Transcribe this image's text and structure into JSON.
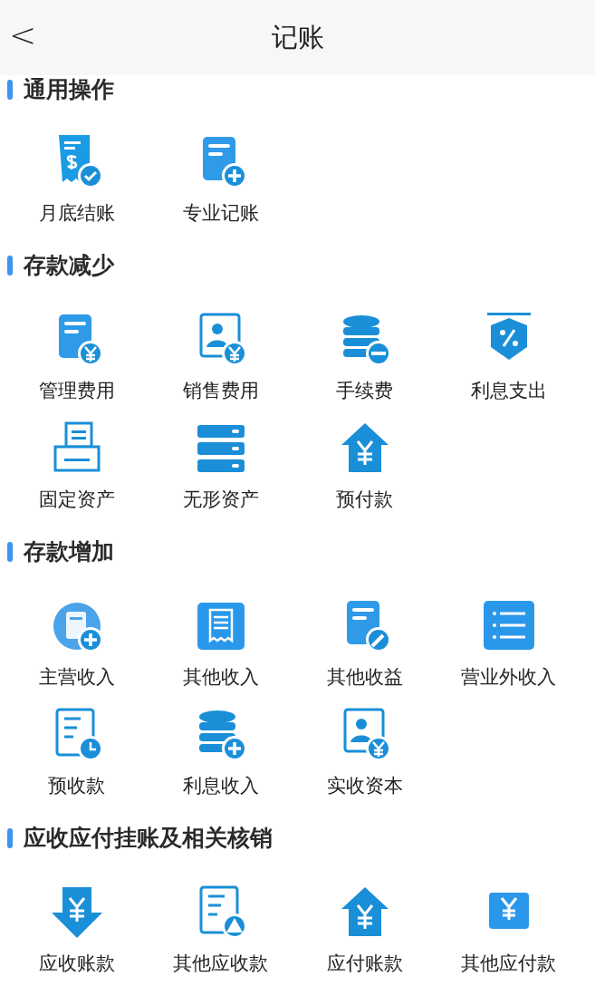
{
  "header": {
    "back": "<",
    "title": "记账"
  },
  "sections": [
    {
      "title": "通用操作",
      "items": [
        {
          "label": "月底结账"
        },
        {
          "label": "专业记账"
        }
      ]
    },
    {
      "title": "存款减少",
      "items": [
        {
          "label": "管理费用"
        },
        {
          "label": "销售费用"
        },
        {
          "label": "手续费"
        },
        {
          "label": "利息支出"
        },
        {
          "label": "固定资产"
        },
        {
          "label": "无形资产"
        },
        {
          "label": "预付款"
        }
      ]
    },
    {
      "title": "存款增加",
      "items": [
        {
          "label": "主营收入"
        },
        {
          "label": "其他收入"
        },
        {
          "label": "其他收益"
        },
        {
          "label": "营业外收入"
        },
        {
          "label": "预收款"
        },
        {
          "label": "利息收入"
        },
        {
          "label": "实收资本"
        }
      ]
    },
    {
      "title": "应收应付挂账及相关核销",
      "items": [
        {
          "label": "应收账款"
        },
        {
          "label": "其他应收款"
        },
        {
          "label": "应付账款"
        },
        {
          "label": "其他应付款"
        }
      ]
    }
  ]
}
